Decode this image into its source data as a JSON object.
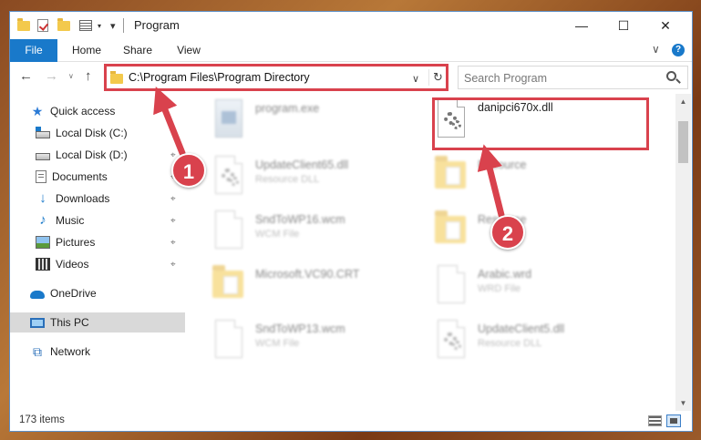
{
  "window": {
    "title": "Program",
    "minimize_glyph": "—",
    "maximize_glyph": "☐",
    "close_glyph": "✕"
  },
  "ribbon": {
    "tabs": [
      {
        "label": "File",
        "active": true
      },
      {
        "label": "Home"
      },
      {
        "label": "Share"
      },
      {
        "label": "View"
      }
    ],
    "collapse_glyph": "∨",
    "help_glyph": "?"
  },
  "navigation": {
    "back_glyph": "←",
    "forward_glyph": "→",
    "up_glyph": "↑",
    "recent_glyph": "∨",
    "address_path": "C:\\Program Files\\Program Directory",
    "address_dropdown_glyph": "∨",
    "refresh_glyph": "↻",
    "search_placeholder": "Search Program"
  },
  "sidebar": {
    "items": [
      {
        "label": "Quick access",
        "icon": "star-icon"
      },
      {
        "label": "Local Disk (C:)",
        "icon": "drive-icon",
        "pinned": true
      },
      {
        "label": "Local Disk (D:)",
        "icon": "drive-icon",
        "pinned": true
      },
      {
        "label": "Documents",
        "icon": "documents-icon",
        "pinned": true
      },
      {
        "label": "Downloads",
        "icon": "downloads-icon",
        "pinned": true
      },
      {
        "label": "Music",
        "icon": "music-icon",
        "pinned": true
      },
      {
        "label": "Pictures",
        "icon": "pictures-icon",
        "pinned": true
      },
      {
        "label": "Videos",
        "icon": "videos-icon",
        "pinned": true
      },
      {
        "label": "OneDrive",
        "icon": "cloud-icon"
      },
      {
        "label": "This PC",
        "icon": "pc-icon",
        "selected": true
      },
      {
        "label": "Network",
        "icon": "network-icon"
      }
    ],
    "pin_glyph": "⌖"
  },
  "files": [
    {
      "name": "program.exe",
      "desc": "",
      "icon": "exe-icon"
    },
    {
      "name": "danipci670x.dll",
      "desc": "",
      "icon": "dll-icon",
      "highlighted": true
    },
    {
      "name": "UpdateClient65.dll",
      "desc": "Resource DLL",
      "icon": "dll-icon"
    },
    {
      "name": "Resource",
      "desc": "",
      "icon": "folder-icon"
    },
    {
      "name": "SndToWP16.wcm",
      "desc": "WCM File",
      "icon": "file-icon"
    },
    {
      "name": "Resource",
      "desc": "",
      "icon": "folder-icon"
    },
    {
      "name": "Microsoft.VC90.CRT",
      "desc": "",
      "icon": "folder-icon"
    },
    {
      "name": "Arabic.wrd",
      "desc": "WRD File",
      "icon": "file-icon"
    },
    {
      "name": "SndToWP13.wcm",
      "desc": "WCM File",
      "icon": "file-icon"
    },
    {
      "name": "UpdateClient5.dll",
      "desc": "Resource DLL",
      "icon": "dll-icon"
    }
  ],
  "scrollbar": {
    "up_glyph": "▲",
    "down_glyph": "▼"
  },
  "status": {
    "item_count": "173 items"
  },
  "annotations": {
    "callout_1": "1",
    "callout_2": "2",
    "color": "#d9424d"
  },
  "colors": {
    "accent": "#1979ca",
    "highlight": "#d9424d"
  }
}
